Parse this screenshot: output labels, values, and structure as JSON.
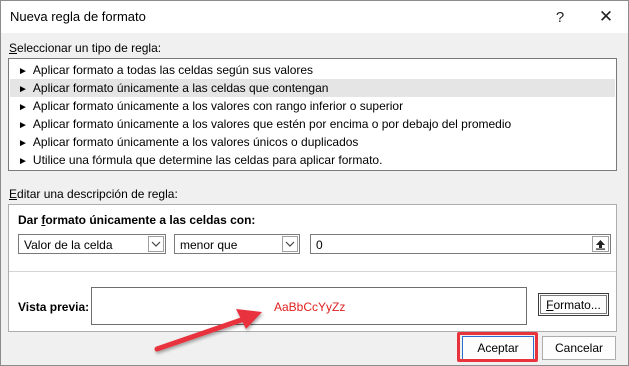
{
  "window": {
    "title": "Nueva regla de formato",
    "help_glyph": "?",
    "close_glyph": "✕"
  },
  "rule_type": {
    "label_pre": "S",
    "label_rest": "eleccionar un tipo de regla:",
    "items": [
      {
        "label": "Aplicar formato a todas las celdas según sus valores",
        "selected": false
      },
      {
        "label": "Aplicar formato únicamente a las celdas que contengan",
        "selected": true
      },
      {
        "label": "Aplicar formato únicamente a los valores con rango inferior o superior",
        "selected": false
      },
      {
        "label": "Aplicar formato únicamente a los valores que estén por encima o por debajo del promedio",
        "selected": false
      },
      {
        "label": "Aplicar formato únicamente a los valores únicos o duplicados",
        "selected": false
      },
      {
        "label": "Utilice una fórmula que determine las celdas para aplicar formato.",
        "selected": false
      }
    ]
  },
  "description": {
    "label_pre": "E",
    "label_rest": "ditar una descripción de regla:",
    "panel_title_pre": "Dar ",
    "panel_title_ul": "f",
    "panel_title_post": "ormato únicamente a las celdas con:",
    "condition_type": "Valor de la celda",
    "operator": "menor que",
    "value": "0",
    "preview_label": "Vista previa:",
    "preview_sample": "AaBbCcYyZz",
    "preview_color": "#e02020",
    "format_button_ul": "F",
    "format_button_rest": "ormato..."
  },
  "footer": {
    "ok_label": "Aceptar",
    "cancel_label": "Cancelar",
    "highlight_color": "#e8323c"
  }
}
